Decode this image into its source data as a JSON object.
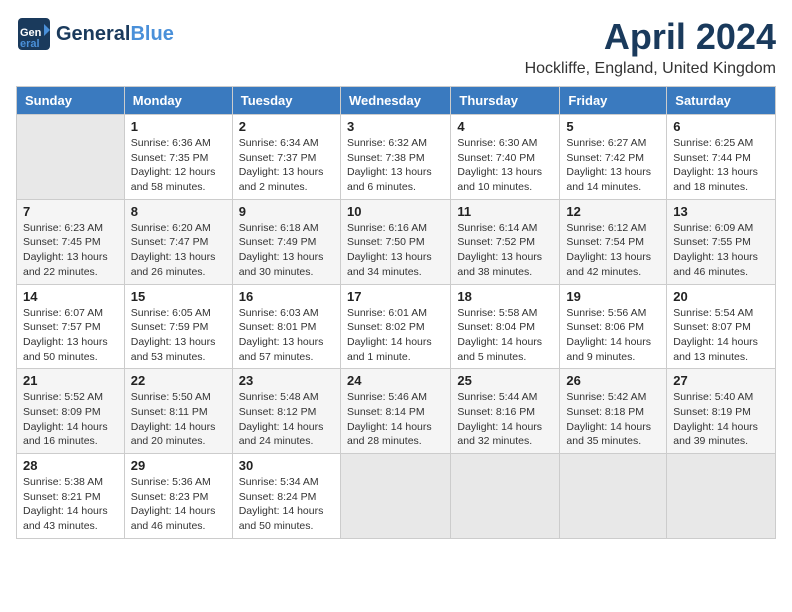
{
  "header": {
    "logo_line1": "General",
    "logo_line2": "Blue",
    "title": "April 2024",
    "subtitle": "Hockliffe, England, United Kingdom"
  },
  "days_of_week": [
    "Sunday",
    "Monday",
    "Tuesday",
    "Wednesday",
    "Thursday",
    "Friday",
    "Saturday"
  ],
  "weeks": [
    [
      {
        "day": "",
        "empty": true
      },
      {
        "day": "1",
        "sunrise": "Sunrise: 6:36 AM",
        "sunset": "Sunset: 7:35 PM",
        "daylight": "Daylight: 12 hours and 58 minutes."
      },
      {
        "day": "2",
        "sunrise": "Sunrise: 6:34 AM",
        "sunset": "Sunset: 7:37 PM",
        "daylight": "Daylight: 13 hours and 2 minutes."
      },
      {
        "day": "3",
        "sunrise": "Sunrise: 6:32 AM",
        "sunset": "Sunset: 7:38 PM",
        "daylight": "Daylight: 13 hours and 6 minutes."
      },
      {
        "day": "4",
        "sunrise": "Sunrise: 6:30 AM",
        "sunset": "Sunset: 7:40 PM",
        "daylight": "Daylight: 13 hours and 10 minutes."
      },
      {
        "day": "5",
        "sunrise": "Sunrise: 6:27 AM",
        "sunset": "Sunset: 7:42 PM",
        "daylight": "Daylight: 13 hours and 14 minutes."
      },
      {
        "day": "6",
        "sunrise": "Sunrise: 6:25 AM",
        "sunset": "Sunset: 7:44 PM",
        "daylight": "Daylight: 13 hours and 18 minutes."
      }
    ],
    [
      {
        "day": "7",
        "sunrise": "Sunrise: 6:23 AM",
        "sunset": "Sunset: 7:45 PM",
        "daylight": "Daylight: 13 hours and 22 minutes."
      },
      {
        "day": "8",
        "sunrise": "Sunrise: 6:20 AM",
        "sunset": "Sunset: 7:47 PM",
        "daylight": "Daylight: 13 hours and 26 minutes."
      },
      {
        "day": "9",
        "sunrise": "Sunrise: 6:18 AM",
        "sunset": "Sunset: 7:49 PM",
        "daylight": "Daylight: 13 hours and 30 minutes."
      },
      {
        "day": "10",
        "sunrise": "Sunrise: 6:16 AM",
        "sunset": "Sunset: 7:50 PM",
        "daylight": "Daylight: 13 hours and 34 minutes."
      },
      {
        "day": "11",
        "sunrise": "Sunrise: 6:14 AM",
        "sunset": "Sunset: 7:52 PM",
        "daylight": "Daylight: 13 hours and 38 minutes."
      },
      {
        "day": "12",
        "sunrise": "Sunrise: 6:12 AM",
        "sunset": "Sunset: 7:54 PM",
        "daylight": "Daylight: 13 hours and 42 minutes."
      },
      {
        "day": "13",
        "sunrise": "Sunrise: 6:09 AM",
        "sunset": "Sunset: 7:55 PM",
        "daylight": "Daylight: 13 hours and 46 minutes."
      }
    ],
    [
      {
        "day": "14",
        "sunrise": "Sunrise: 6:07 AM",
        "sunset": "Sunset: 7:57 PM",
        "daylight": "Daylight: 13 hours and 50 minutes."
      },
      {
        "day": "15",
        "sunrise": "Sunrise: 6:05 AM",
        "sunset": "Sunset: 7:59 PM",
        "daylight": "Daylight: 13 hours and 53 minutes."
      },
      {
        "day": "16",
        "sunrise": "Sunrise: 6:03 AM",
        "sunset": "Sunset: 8:01 PM",
        "daylight": "Daylight: 13 hours and 57 minutes."
      },
      {
        "day": "17",
        "sunrise": "Sunrise: 6:01 AM",
        "sunset": "Sunset: 8:02 PM",
        "daylight": "Daylight: 14 hours and 1 minute."
      },
      {
        "day": "18",
        "sunrise": "Sunrise: 5:58 AM",
        "sunset": "Sunset: 8:04 PM",
        "daylight": "Daylight: 14 hours and 5 minutes."
      },
      {
        "day": "19",
        "sunrise": "Sunrise: 5:56 AM",
        "sunset": "Sunset: 8:06 PM",
        "daylight": "Daylight: 14 hours and 9 minutes."
      },
      {
        "day": "20",
        "sunrise": "Sunrise: 5:54 AM",
        "sunset": "Sunset: 8:07 PM",
        "daylight": "Daylight: 14 hours and 13 minutes."
      }
    ],
    [
      {
        "day": "21",
        "sunrise": "Sunrise: 5:52 AM",
        "sunset": "Sunset: 8:09 PM",
        "daylight": "Daylight: 14 hours and 16 minutes."
      },
      {
        "day": "22",
        "sunrise": "Sunrise: 5:50 AM",
        "sunset": "Sunset: 8:11 PM",
        "daylight": "Daylight: 14 hours and 20 minutes."
      },
      {
        "day": "23",
        "sunrise": "Sunrise: 5:48 AM",
        "sunset": "Sunset: 8:12 PM",
        "daylight": "Daylight: 14 hours and 24 minutes."
      },
      {
        "day": "24",
        "sunrise": "Sunrise: 5:46 AM",
        "sunset": "Sunset: 8:14 PM",
        "daylight": "Daylight: 14 hours and 28 minutes."
      },
      {
        "day": "25",
        "sunrise": "Sunrise: 5:44 AM",
        "sunset": "Sunset: 8:16 PM",
        "daylight": "Daylight: 14 hours and 32 minutes."
      },
      {
        "day": "26",
        "sunrise": "Sunrise: 5:42 AM",
        "sunset": "Sunset: 8:18 PM",
        "daylight": "Daylight: 14 hours and 35 minutes."
      },
      {
        "day": "27",
        "sunrise": "Sunrise: 5:40 AM",
        "sunset": "Sunset: 8:19 PM",
        "daylight": "Daylight: 14 hours and 39 minutes."
      }
    ],
    [
      {
        "day": "28",
        "sunrise": "Sunrise: 5:38 AM",
        "sunset": "Sunset: 8:21 PM",
        "daylight": "Daylight: 14 hours and 43 minutes."
      },
      {
        "day": "29",
        "sunrise": "Sunrise: 5:36 AM",
        "sunset": "Sunset: 8:23 PM",
        "daylight": "Daylight: 14 hours and 46 minutes."
      },
      {
        "day": "30",
        "sunrise": "Sunrise: 5:34 AM",
        "sunset": "Sunset: 8:24 PM",
        "daylight": "Daylight: 14 hours and 50 minutes."
      },
      {
        "day": "",
        "empty": true
      },
      {
        "day": "",
        "empty": true
      },
      {
        "day": "",
        "empty": true
      },
      {
        "day": "",
        "empty": true
      }
    ]
  ]
}
